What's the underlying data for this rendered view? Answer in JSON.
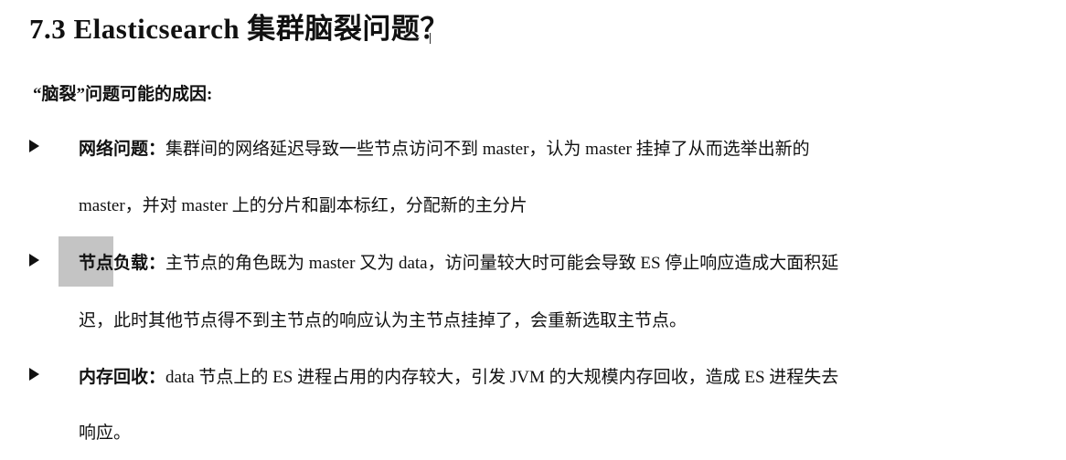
{
  "title": "7.3 Elasticsearch 集群脑裂问题？",
  "subheading": "“脑裂”问题可能的成因:",
  "items": [
    {
      "term": "网络问题",
      "sep": "：",
      "line1": "集群间的网络延迟导致一些节点访问不到 master，认为 master 挂掉了从而选举出新的",
      "line2": "master，并对 master 上的分片和副本标红，分配新的主分片"
    },
    {
      "term_a": "节点",
      "term_b": "负载",
      "sep": "：",
      "line1": "主节点的角色既为 master 又为 data，访问量较大时可能会导致 ES 停止响应造成大面积延",
      "line2": "迟，此时其他节点得不到主节点的响应认为主节点挂掉了，会重新选取主节点。"
    },
    {
      "term": "内存回收",
      "sep": "：",
      "line1": "data 节点上的 ES 进程占用的内存较大，引发 JVM 的大规模内存回收，造成 ES 进程失去",
      "line2": "响应。"
    }
  ]
}
